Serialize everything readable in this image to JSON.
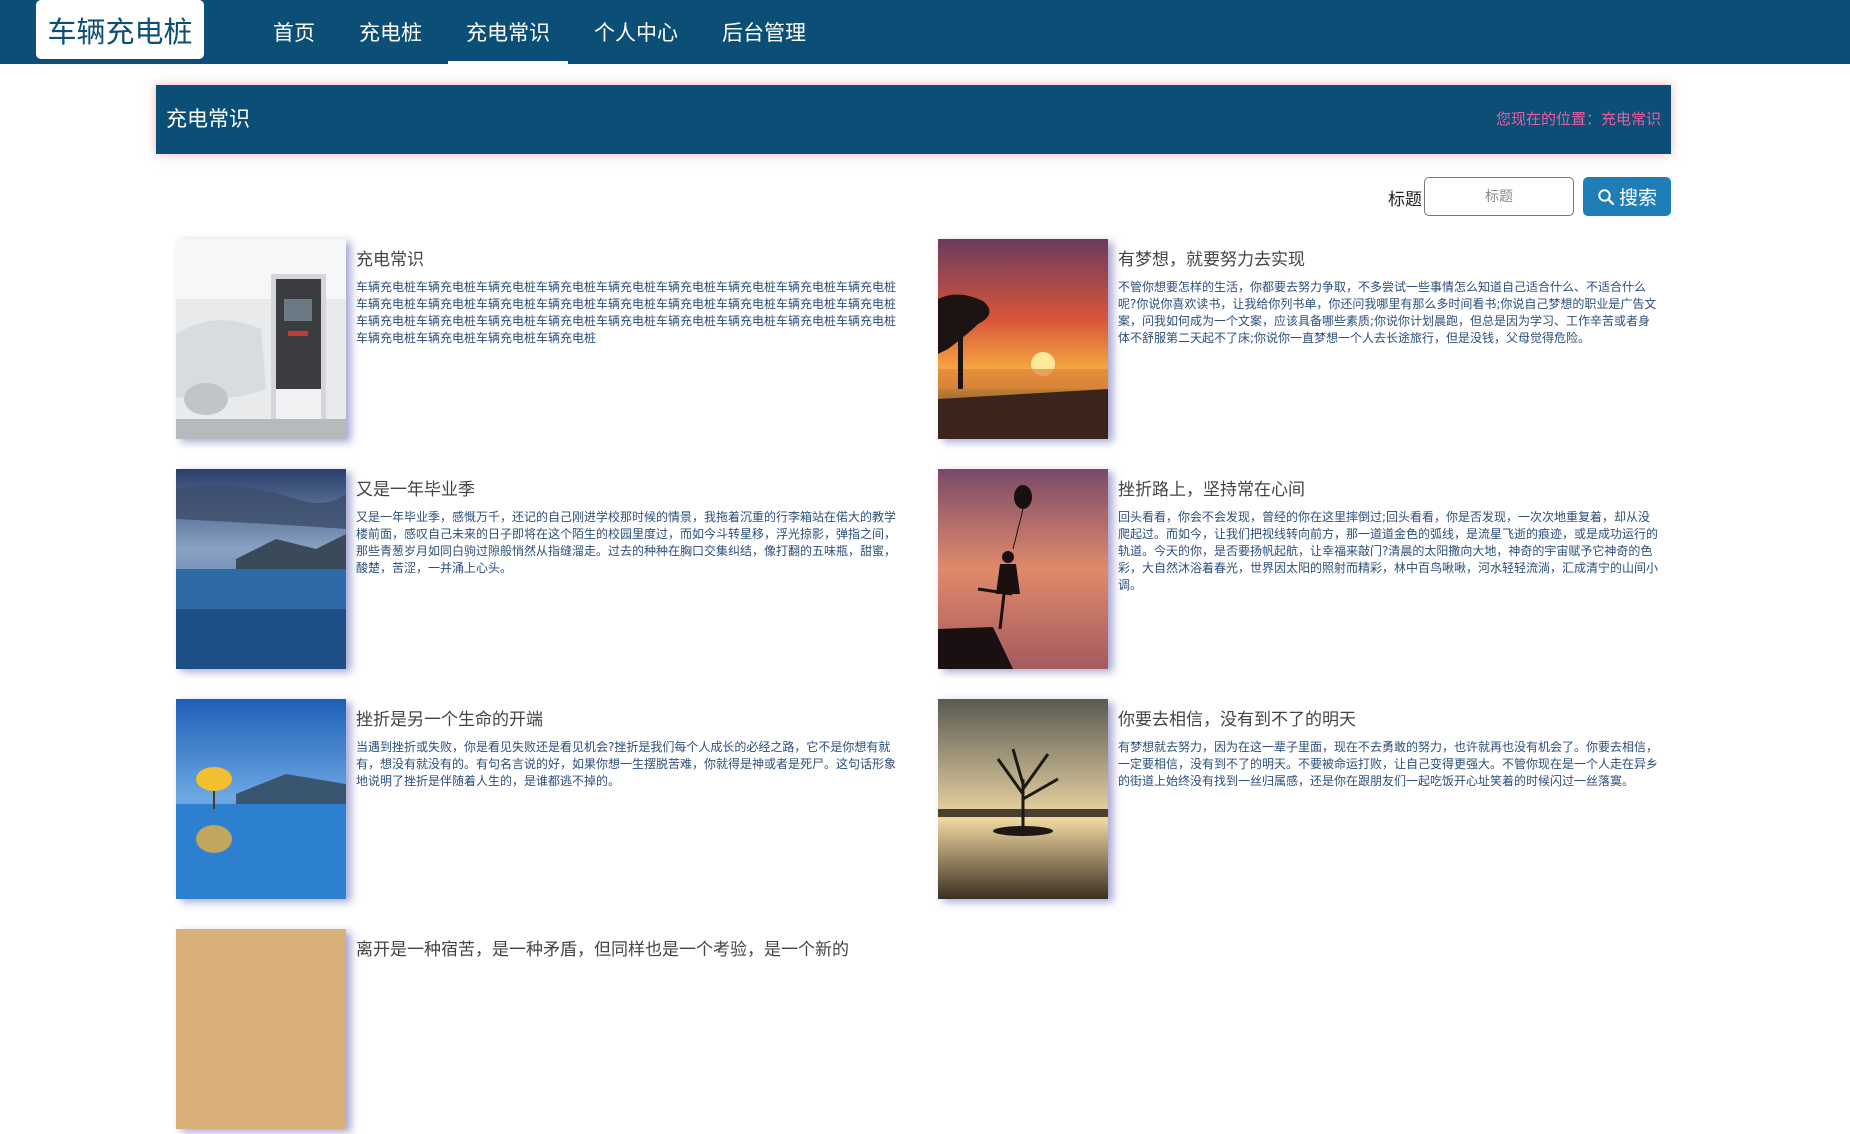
{
  "header": {
    "logo": "车辆充电桩",
    "nav": [
      "首页",
      "充电桩",
      "充电常识",
      "个人中心",
      "后台管理"
    ]
  },
  "banner": {
    "title": "充电常识",
    "breadcrumb": "您现在的位置：充电常识"
  },
  "search": {
    "label": "标题",
    "placeholder": "标题",
    "button": "搜索"
  },
  "articles": [
    {
      "title": "充电常识",
      "summary": "车辆充电桩车辆充电桩车辆充电桩车辆充电桩车辆充电桩车辆充电桩车辆充电桩车辆充电桩车辆充电桩车辆充电桩车辆充电桩车辆充电桩车辆充电桩车辆充电桩车辆充电桩车辆充电桩车辆充电桩车辆充电桩车辆充电桩车辆充电桩车辆充电桩车辆充电桩车辆充电桩车辆充电桩车辆充电桩车辆充电桩车辆充电桩车辆充电桩车辆充电桩车辆充电桩车辆充电桩"
    },
    {
      "title": "有梦想，就要努力去实现",
      "summary": "不管你想要怎样的生活，你都要去努力争取，不多尝试一些事情怎么知道自己适合什么、不适合什么呢?你说你喜欢读书，让我给你列书单，你还问我哪里有那么多时间看书;你说自己梦想的职业是广告文案，问我如何成为一个文案，应该具备哪些素质;你说你计划晨跑，但总是因为学习、工作辛苦或者身体不舒服第二天起不了床;你说你一直梦想一个人去长途旅行，但是没钱，父母觉得危险。"
    },
    {
      "title": "又是一年毕业季",
      "summary": "又是一年毕业季，感慨万千，还记的自己刚进学校那时候的情景，我拖着沉重的行李箱站在偌大的教学楼前面，感叹自己未来的日子即将在这个陌生的校园里度过，而如今斗转星移，浮光掠影，弹指之间，那些青葱岁月如同白驹过隙般悄然从指缝溜走。过去的种种在胸口交集纠结，像打翻的五味瓶，甜蜜，酸楚，苦涩，一并涌上心头。"
    },
    {
      "title": "挫折路上，坚持常在心间",
      "summary": "回头看看，你会不会发现，曾经的你在这里摔倒过;回头看看，你是否发现，一次次地重复着，却从没爬起过。而如今，让我们把视线转向前方，那一道道金色的弧线，是流星飞逝的痕迹，或是成功运行的轨道。今天的你，是否要扬帆起航，让幸福来敲门?清晨的太阳撒向大地，神奇的宇宙赋予它神奇的色彩，大自然沐浴着春光，世界因太阳的照射而精彩，林中百鸟啾啾，河水轻轻流淌，汇成清宁的山间小调。"
    },
    {
      "title": "挫折是另一个生命的开端",
      "summary": "当遇到挫折或失败，你是看见失败还是看见机会?挫折是我们每个人成长的必经之路，它不是你想有就有，想没有就没有的。有句名言说的好，如果你想一生摆脱苦难，你就得是神或者是死尸。这句话形象地说明了挫折是伴随着人生的，是谁都逃不掉的。"
    },
    {
      "title": "你要去相信，没有到不了的明天",
      "summary": "有梦想就去努力，因为在这一辈子里面，现在不去勇敢的努力，也许就再也没有机会了。你要去相信，一定要相信，没有到不了的明天。不要被命运打败，让自己变得更强大。不管你现在是一个人走在异乡的街道上始终没有找到一丝归属感，还是你在跟朋友们一起吃饭开心址笑着的时候闪过一丝落寞。"
    },
    {
      "title": "离开是一种宿苦，是一种矛盾，但同样也是一个考验，是一个新的",
      "summary": ""
    }
  ]
}
